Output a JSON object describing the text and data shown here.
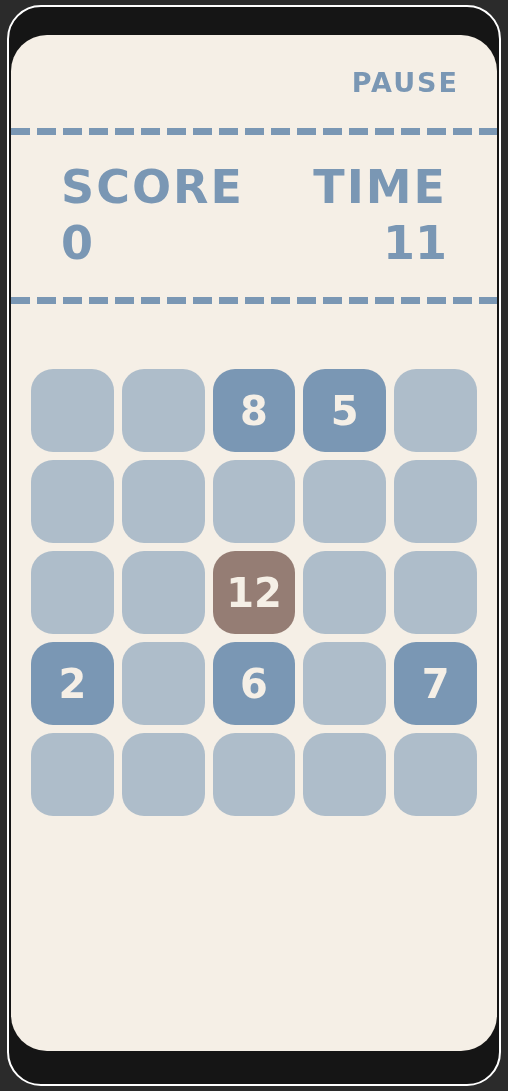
{
  "pause_button": "PAUSE",
  "score": {
    "label": "SCORE",
    "value": "0"
  },
  "time": {
    "label": "TIME",
    "value": "11"
  },
  "board": [
    [
      {
        "kind": "empty"
      },
      {
        "kind": "empty"
      },
      {
        "kind": "number",
        "value": "8"
      },
      {
        "kind": "number",
        "value": "5"
      },
      {
        "kind": "empty"
      }
    ],
    [
      {
        "kind": "empty"
      },
      {
        "kind": "empty"
      },
      {
        "kind": "empty"
      },
      {
        "kind": "empty"
      },
      {
        "kind": "empty"
      }
    ],
    [
      {
        "kind": "empty"
      },
      {
        "kind": "empty"
      },
      {
        "kind": "target",
        "value": "12"
      },
      {
        "kind": "empty"
      },
      {
        "kind": "empty"
      }
    ],
    [
      {
        "kind": "number",
        "value": "2"
      },
      {
        "kind": "empty"
      },
      {
        "kind": "number",
        "value": "6"
      },
      {
        "kind": "empty"
      },
      {
        "kind": "number",
        "value": "7"
      }
    ],
    [
      {
        "kind": "empty"
      },
      {
        "kind": "empty"
      },
      {
        "kind": "empty"
      },
      {
        "kind": "empty"
      },
      {
        "kind": "empty"
      }
    ]
  ]
}
